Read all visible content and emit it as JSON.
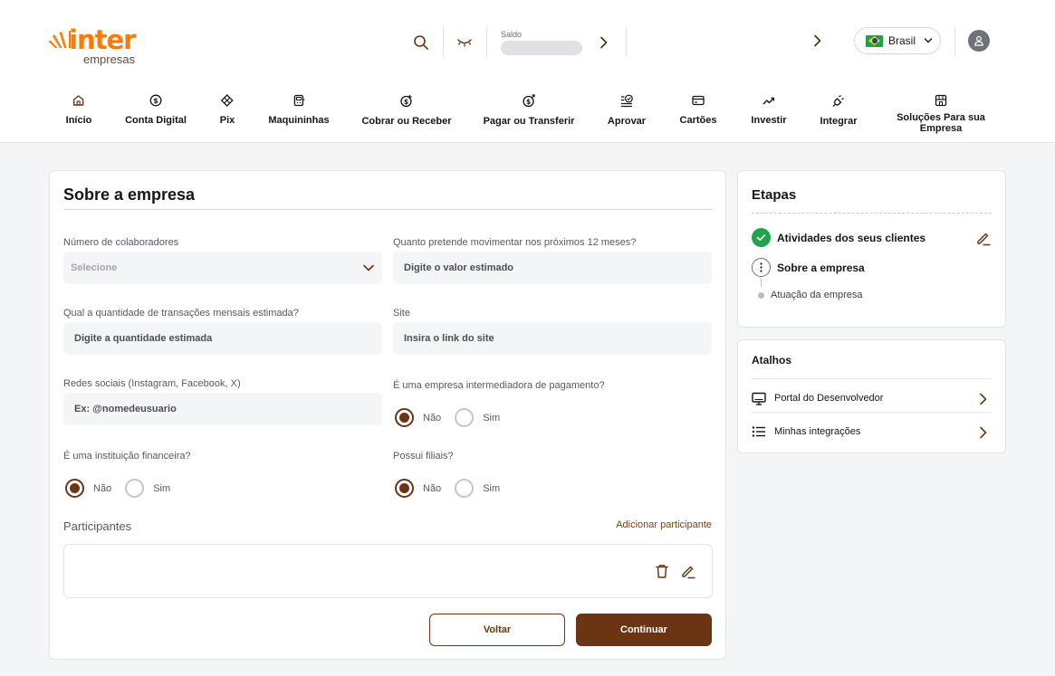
{
  "brand": {
    "name": "inter",
    "sub": "empresas",
    "color": "#ff7a00",
    "accent": "#6b3413"
  },
  "header": {
    "saldo_label": "Saldo",
    "country": "Brasil",
    "icons": [
      "search-icon",
      "eye-closed-icon",
      "chevron-right-icon",
      "chevron-right-icon",
      "user-icon"
    ]
  },
  "nav": [
    {
      "label": "Início",
      "icon": "home-icon"
    },
    {
      "label": "Conta Digital",
      "icon": "dollar-circle-icon"
    },
    {
      "label": "Pix",
      "icon": "pix-icon"
    },
    {
      "label": "Maquininhas",
      "icon": "pos-terminal-icon"
    },
    {
      "label": "Cobrar ou Receber",
      "icon": "receive-money-icon"
    },
    {
      "label": "Pagar ou Transferir",
      "icon": "send-money-icon"
    },
    {
      "label": "Aprovar",
      "icon": "approve-icon"
    },
    {
      "label": "Cartões",
      "icon": "card-icon"
    },
    {
      "label": "Investir",
      "icon": "trend-up-icon"
    },
    {
      "label": "Integrar",
      "icon": "plug-icon"
    },
    {
      "label": "Soluções Para sua Empresa",
      "icon": "store-icon"
    }
  ],
  "form": {
    "title": "Sobre a empresa",
    "colaboradores": {
      "label": "Número de colaboradores",
      "placeholder": "Selecione"
    },
    "movimentar": {
      "label": "Quanto pretende movimentar nos próximos 12 meses?",
      "placeholder": "Digite o valor estimado"
    },
    "transacoes": {
      "label": "Qual a quantidade de transações mensais estimada?",
      "placeholder": "Digite a quantidade estimada"
    },
    "site": {
      "label": "Site",
      "placeholder": "Insira o link do site"
    },
    "redes": {
      "label": "Redes sociais (Instagram, Facebook, X)",
      "placeholder": "Ex: @nomedeusuario"
    },
    "intermediadora": {
      "label": "É uma empresa intermediadora de pagamento?",
      "no": "Não",
      "yes": "Sim",
      "selected": "Não"
    },
    "financeira": {
      "label": "É uma instituição financeira?",
      "no": "Não",
      "yes": "Sim",
      "selected": "Não"
    },
    "filiais": {
      "label": "Possui filiais?",
      "no": "Não",
      "yes": "Sim",
      "selected": "Não"
    },
    "participantes": {
      "title": "Participantes",
      "add_label": "Adicionar participante"
    },
    "back_label": "Voltar",
    "next_label": "Continuar"
  },
  "steps": {
    "title": "Etapas",
    "items": [
      {
        "label": "Atividades dos seus clientes",
        "state": "done"
      },
      {
        "label": "Sobre a empresa",
        "state": "current"
      },
      {
        "label": "Atuação da empresa",
        "state": "pending"
      }
    ]
  },
  "shortcuts": {
    "title": "Atalhos",
    "items": [
      {
        "label": "Portal do Desenvolvedor",
        "icon": "monitor-icon"
      },
      {
        "label": "Minhas integrações",
        "icon": "list-icon"
      }
    ]
  }
}
